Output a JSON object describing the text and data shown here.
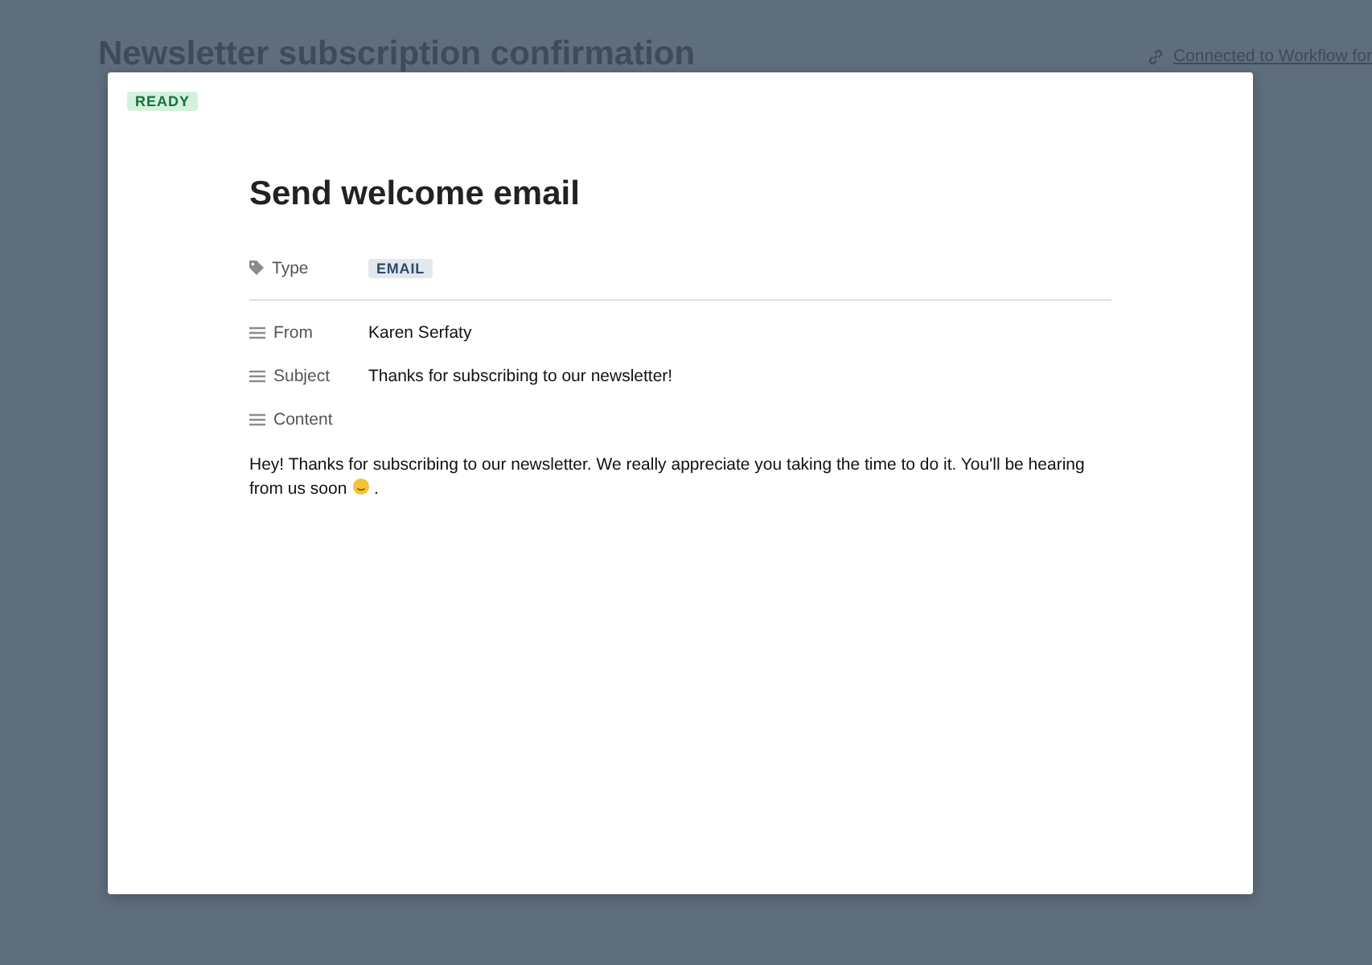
{
  "page": {
    "title": "Newsletter subscription confirmation",
    "link": "Connected to Workflow for"
  },
  "modal": {
    "status": "READY",
    "title": "Send welcome email",
    "properties": [
      {
        "kind": "tag",
        "label": "Type",
        "value": "EMAIL"
      },
      {
        "kind": "text",
        "label": "From",
        "value": "Karen Serfaty"
      },
      {
        "kind": "text",
        "label": "Subject",
        "value": "Thanks for subscribing to our newsletter!"
      },
      {
        "kind": "text",
        "label": "Content"
      }
    ],
    "content": {
      "text": "Hey! Thanks for subscribing to our newsletter. We really appreciate you taking the time to do it. You'll be hearing from us soon",
      "after": " ."
    }
  }
}
